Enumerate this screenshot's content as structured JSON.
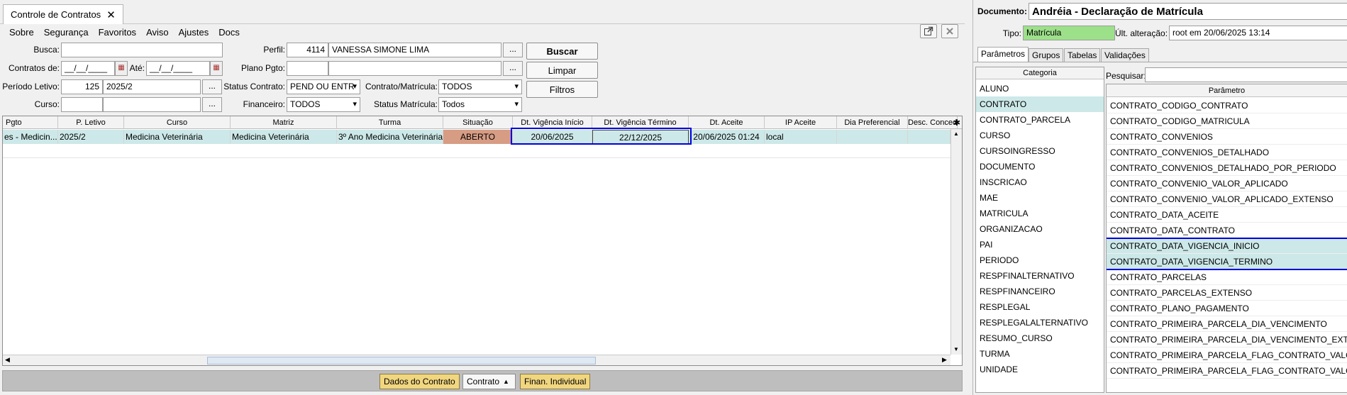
{
  "window": {
    "tab_title": "Controle de Contratos",
    "tab_close": "✕"
  },
  "menu": [
    "Sobre",
    "Segurança",
    "Favoritos",
    "Aviso",
    "Ajustes",
    "Docs"
  ],
  "form": {
    "busca_label": "Busca:",
    "busca_value": "",
    "perfil_label": "Perfil:",
    "perfil_code": "4114",
    "perfil_name": "VANESSA SIMONE LIMA",
    "contratos_de_label": "Contratos de:",
    "contratos_de_value": "__/__/____",
    "ate_label": "Até:",
    "ate_value": "__/__/____",
    "plano_pgto_label": "Plano Pgto:",
    "plano_pgto_code": "",
    "plano_pgto_name": "",
    "periodo_label": "Período Letivo:",
    "periodo_code": "125",
    "periodo_name": "2025/2",
    "status_contrato_label": "Status Contrato:",
    "status_contrato_value": "PEND OU ENTR",
    "contrato_matricula_label": "Contrato/Matrícula:",
    "contrato_matricula_value": "TODOS",
    "curso_label": "Curso:",
    "curso_code": "",
    "curso_name": "",
    "financeiro_label": "Financeiro:",
    "financeiro_value": "TODOS",
    "status_matricula_label": "Status Matrícula:",
    "status_matricula_value": "Todos",
    "dots": "...",
    "buscar": "Buscar",
    "limpar": "Limpar",
    "filtros": "Filtros"
  },
  "grid": {
    "columns": [
      "Pgto",
      "P. Letivo",
      "Curso",
      "Matriz",
      "Turma",
      "Situação",
      "Dt. Vigência Início",
      "Dt. Vigência Término",
      "Dt. Aceite",
      "IP Aceite",
      "Dia Preferencial",
      "Desc. Conced"
    ],
    "rows": [
      [
        "es - Medicin...",
        "2025/2",
        "Medicina Veterinária",
        "Medicina Veterinária",
        "3º Ano Medicina Veterinária",
        "ABERTO",
        "20/06/2025",
        "22/12/2025",
        "20/06/2025 01:24",
        "local",
        "",
        ""
      ]
    ]
  },
  "bottom": {
    "dados": "Dados do Contrato",
    "contrato": "Contrato",
    "finan": "Finan. Individual"
  },
  "right": {
    "documento_label": "Documento:",
    "documento_value": "Andréia - Declaração de Matrícula",
    "tipo_label": "Tipo:",
    "tipo_value": "Matrícula",
    "ult_label": "Últ. alteração:",
    "ult_value": "root em 20/06/2025 13:14",
    "tabs": [
      "Parâmetros",
      "Grupos",
      "Tabelas",
      "Validações"
    ],
    "categoria_header": "Categoria",
    "pesquisar_label": "Pesquisar:",
    "parametro_header": "Parâmetro",
    "categories": [
      "ALUNO",
      "CONTRATO",
      "CONTRATO_PARCELA",
      "CURSO",
      "CURSOINGRESSO",
      "DOCUMENTO",
      "INSCRICAO",
      "MAE",
      "MATRICULA",
      "ORGANIZACAO",
      "PAI",
      "PERIODO",
      "RESPFINALTERNATIVO",
      "RESPFINANCEIRO",
      "RESPLEGAL",
      "RESPLEGALALTERNATIVO",
      "RESUMO_CURSO",
      "TURMA",
      "UNIDADE"
    ],
    "parameters": [
      "CONTRATO_CODIGO_CONTRATO",
      "CONTRATO_CODIGO_MATRICULA",
      "CONTRATO_CONVENIOS",
      "CONTRATO_CONVENIOS_DETALHADO",
      "CONTRATO_CONVENIOS_DETALHADO_POR_PERIODO",
      "CONTRATO_CONVENIO_VALOR_APLICADO",
      "CONTRATO_CONVENIO_VALOR_APLICADO_EXTENSO",
      "CONTRATO_DATA_ACEITE",
      "CONTRATO_DATA_CONTRATO",
      "CONTRATO_DATA_VIGENCIA_INICIO",
      "CONTRATO_DATA_VIGENCIA_TERMINO",
      "CONTRATO_PARCELAS",
      "CONTRATO_PARCELAS_EXTENSO",
      "CONTRATO_PLANO_PAGAMENTO",
      "CONTRATO_PRIMEIRA_PARCELA_DIA_VENCIMENTO",
      "CONTRATO_PRIMEIRA_PARCELA_DIA_VENCIMENTO_EXTENSO",
      "CONTRATO_PRIMEIRA_PARCELA_FLAG_CONTRATO_VALOR",
      "CONTRATO_PRIMEIRA_PARCELA_FLAG_CONTRATO_VALOR_..."
    ]
  },
  "colors": {
    "selection": "#cde8e8",
    "highlight_box": "#0000e0",
    "tipo_bg": "#9de08a",
    "situacao_bg": "#d79c84",
    "gold_button": "#f1d680"
  },
  "icons": {
    "external": "external-link-icon",
    "close": "close-icon"
  }
}
